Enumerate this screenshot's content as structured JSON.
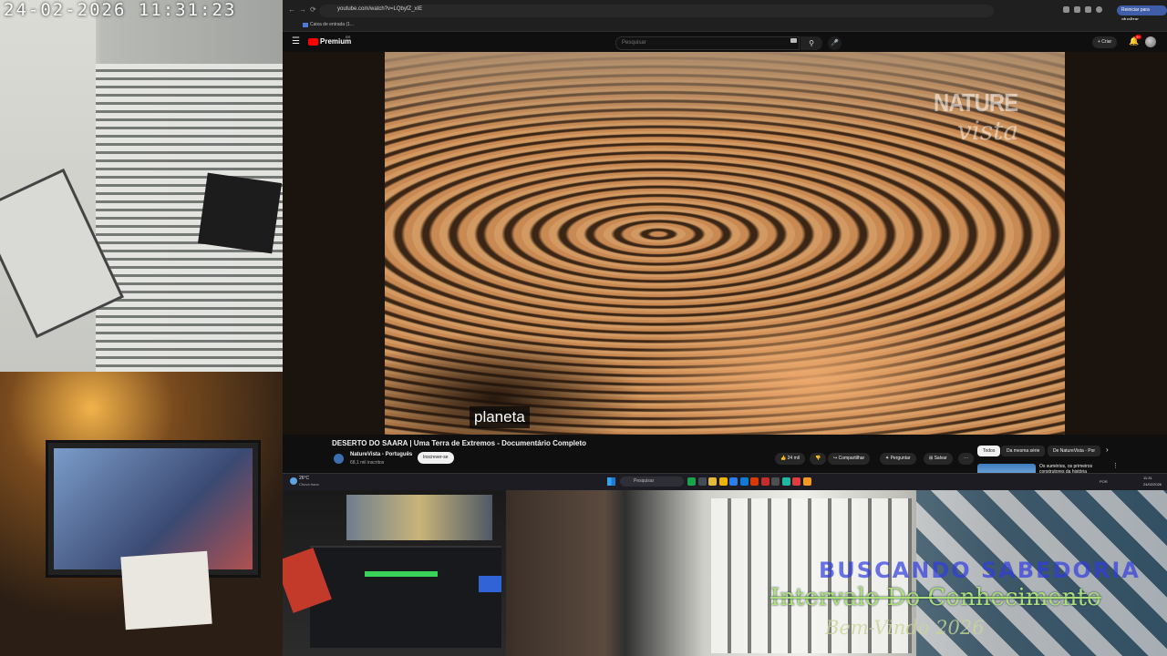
{
  "camera": {
    "timestamp": "24-02-2026  11:31:23",
    "overlay": {
      "line1": "BUSCANDO SABEDORIA",
      "line2": "Intervalo Do Conhecimento",
      "line3": "Bem-Vindo 2026"
    }
  },
  "browser": {
    "url": "youtube.com/watch?v=LQbyfZ_xIE",
    "update_button": "Reiniciar para atualizar",
    "bookmark": "Caixa de entrada (1...",
    "nav": {
      "back": "←",
      "forward": "→",
      "reload": "⟳"
    }
  },
  "youtube": {
    "brand": "Premium",
    "brand_sup": "BR",
    "search_placeholder": "Pesquisar",
    "create_label": "+ Criar",
    "notifications_badge": "9+",
    "video": {
      "watermark_line1": "NATURE",
      "watermark_line2": "vista",
      "caption": "planeta",
      "title": "DESERTO DO SAARA | Uma Terra de Extremos - Documentário Completo"
    },
    "channel": {
      "name": "NatureVista - Português",
      "subscribers": "68,1 mil inscritos",
      "subscribe_label": "Inscrever-se"
    },
    "actions": {
      "like": "👍 24 mil",
      "dislike": "👎",
      "share": "↪ Compartilhar",
      "ask": "✦ Perguntar",
      "save": "⊞ Salvar",
      "more": "···"
    },
    "chips": [
      "Todos",
      "Da mesma série",
      "De NatureVista - Por"
    ],
    "recommendation": {
      "title": "Os sumérios, os primeiros construtores da história"
    }
  },
  "taskbar": {
    "weather_temp": "26°C",
    "weather_desc": "Chuva fraca",
    "search_placeholder": "Pesquisar",
    "lang": "POR",
    "time": "11:31",
    "date": "24/02/2026",
    "app_colors": [
      "#1aa34a",
      "#444c58",
      "#e7b93a",
      "#f0b400",
      "#2b7de9",
      "#0f7bd7",
      "#d83b01",
      "#c72c2c",
      "#4e4e4e",
      "#1fb8a3",
      "#e03c3c",
      "#f59a23"
    ]
  }
}
